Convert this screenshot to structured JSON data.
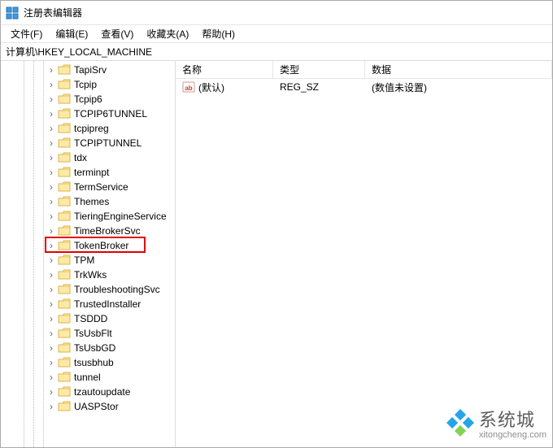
{
  "window": {
    "title": "注册表编辑器"
  },
  "menu": {
    "file": "文件(F)",
    "edit": "编辑(E)",
    "view": "查看(V)",
    "favorites": "收藏夹(A)",
    "help": "帮助(H)"
  },
  "address": {
    "path": "计算机\\HKEY_LOCAL_MACHINE"
  },
  "tree": {
    "items": [
      {
        "label": "TapiSrv"
      },
      {
        "label": "Tcpip"
      },
      {
        "label": "Tcpip6"
      },
      {
        "label": "TCPIP6TUNNEL"
      },
      {
        "label": "tcpipreg"
      },
      {
        "label": "TCPIPTUNNEL"
      },
      {
        "label": "tdx"
      },
      {
        "label": "terminpt"
      },
      {
        "label": "TermService"
      },
      {
        "label": "Themes"
      },
      {
        "label": "TieringEngineService"
      },
      {
        "label": "TimeBrokerSvc"
      },
      {
        "label": "TokenBroker"
      },
      {
        "label": "TPM"
      },
      {
        "label": "TrkWks"
      },
      {
        "label": "TroubleshootingSvc"
      },
      {
        "label": "TrustedInstaller"
      },
      {
        "label": "TSDDD"
      },
      {
        "label": "TsUsbFlt"
      },
      {
        "label": "TsUsbGD"
      },
      {
        "label": "tsusbhub"
      },
      {
        "label": "tunnel"
      },
      {
        "label": "tzautoupdate"
      },
      {
        "label": "UASPStor"
      }
    ],
    "highlighted_index": 12
  },
  "list": {
    "columns": {
      "name": "名称",
      "type": "类型",
      "data": "数据"
    },
    "rows": [
      {
        "name": "(默认)",
        "type": "REG_SZ",
        "data": "(数值未设置)"
      }
    ]
  },
  "watermark": {
    "text": "系统城",
    "url": "xitongcheng.com"
  },
  "colors": {
    "highlight_border": "#e20000",
    "folder_fill": "#ffe9a6",
    "folder_stroke": "#d9b54a"
  }
}
